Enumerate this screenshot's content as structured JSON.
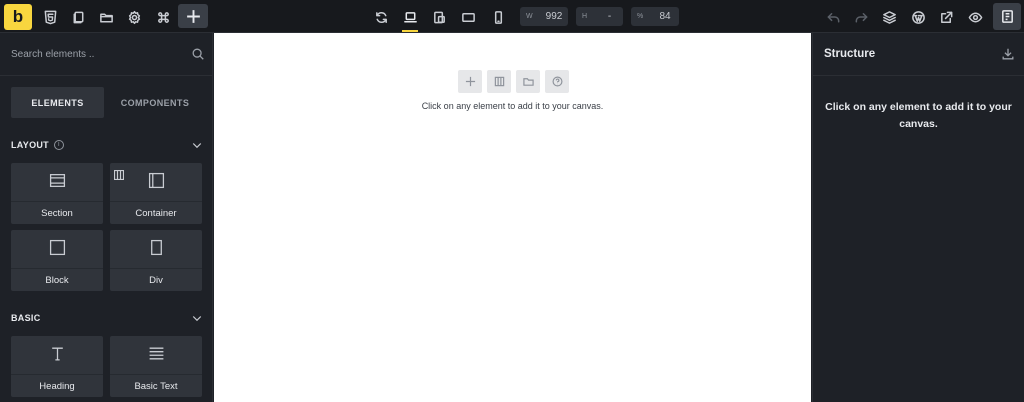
{
  "toolbar": {
    "logo": "b",
    "left_icons": [
      "html5-icon",
      "pages-icon",
      "folder-icon",
      "settings-icon",
      "command-icon"
    ],
    "add_button_icon": "plus-icon",
    "center_icons": [
      "refresh-icon",
      "laptop-icon",
      "tablet-landscape-icon",
      "tablet-icon",
      "mobile-icon"
    ],
    "active_breakpoint": "laptop",
    "width": {
      "key": "W",
      "value": "992"
    },
    "height": {
      "key": "H",
      "value": "-"
    },
    "zoom": {
      "key": "%",
      "value": "84"
    },
    "right_icons": [
      "undo-icon",
      "redo-icon",
      "layers-icon",
      "wordpress-icon",
      "external-link-icon",
      "preview-eye-icon",
      "structure-panel-icon"
    ],
    "accent": "#f8d63f"
  },
  "left_panel": {
    "search_placeholder": "Search elements ..",
    "tabs": [
      {
        "label": "ELEMENTS",
        "active": true
      },
      {
        "label": "COMPONENTS",
        "active": false
      }
    ],
    "groups": [
      {
        "title": "LAYOUT",
        "info": "i",
        "elements": [
          {
            "label": "Section",
            "icon": "section-icon"
          },
          {
            "label": "Container",
            "icon": "container-icon"
          },
          {
            "label": "Block",
            "icon": "block-icon"
          },
          {
            "label": "Div",
            "icon": "div-icon"
          }
        ]
      },
      {
        "title": "BASIC",
        "elements": [
          {
            "label": "Heading",
            "icon": "heading-icon"
          },
          {
            "label": "Basic Text",
            "icon": "text-icon"
          }
        ]
      }
    ]
  },
  "canvas": {
    "buttons": [
      "add-icon",
      "columns-icon",
      "folder-icon",
      "help-icon"
    ],
    "message": "Click on any element to add it to your canvas."
  },
  "structure_panel": {
    "title": "Structure",
    "empty_message": "Click on any element to add it to your canvas."
  }
}
